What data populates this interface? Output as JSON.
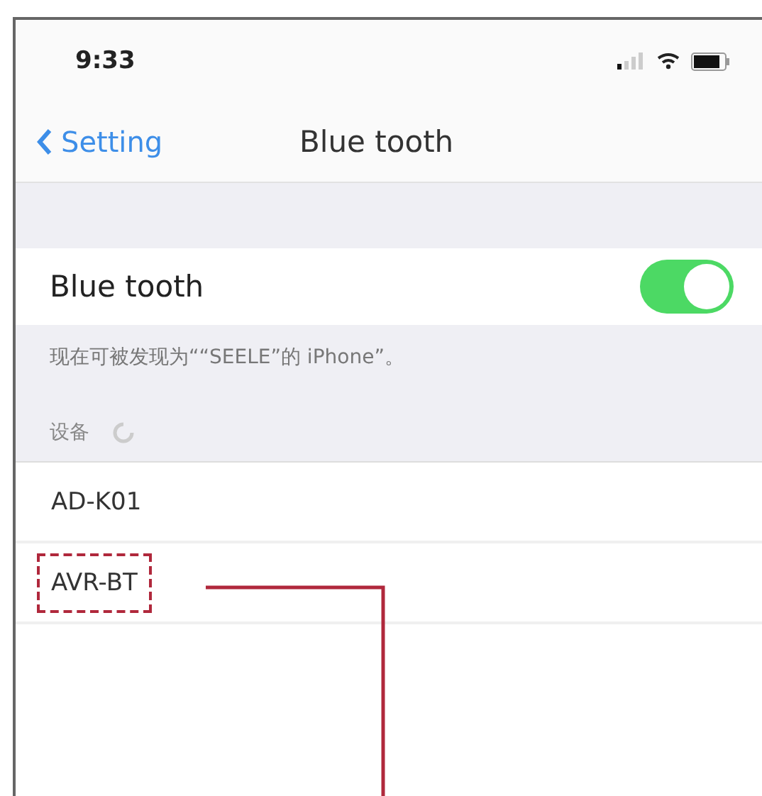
{
  "status_bar": {
    "time": "9:33"
  },
  "nav": {
    "back": "Setting",
    "title": "Blue tooth"
  },
  "bluetooth": {
    "label": "Blue tooth",
    "on": true
  },
  "discoverable_note": "现在可被发现为““SEELE”的 iPhone”。",
  "devices_header": "设备",
  "devices": [
    {
      "name": "AD-K01",
      "highlighted": false
    },
    {
      "name": "AVR-BT",
      "highlighted": true
    }
  ]
}
